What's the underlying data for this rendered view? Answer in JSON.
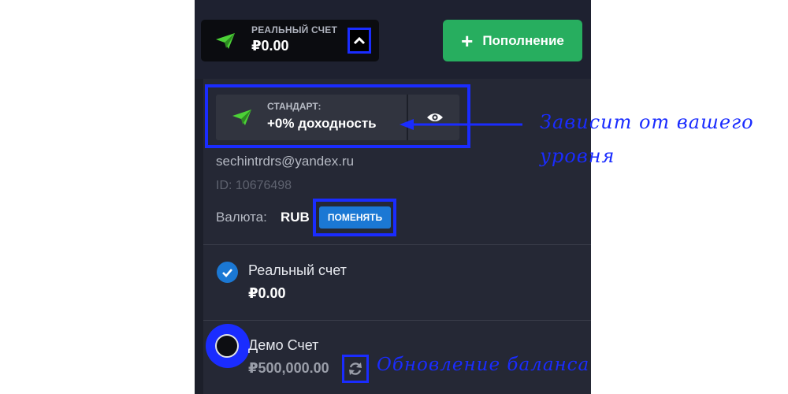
{
  "header": {
    "account_type": "РЕАЛЬНЫЙ СЧЕТ",
    "balance": "₽0.00",
    "deposit_label": "Пополнение"
  },
  "profile": {
    "tier_label": "СТАНДАРТ:",
    "tier_yield": "+0% доходность",
    "email": "sechintrdrs@yandex.ru",
    "id": "ID: 10676498",
    "currency_label": "Валюта:",
    "currency_value": "RUB",
    "change_button": "ПОМЕНЯТЬ"
  },
  "accounts": [
    {
      "label": "Реальный счет",
      "balance": "₽0.00",
      "selected": true
    },
    {
      "label": "Демо Счет",
      "balance": "₽500,000.00",
      "selected": false
    }
  ],
  "annotations": {
    "tier_note_line1": "Зависит от вашего",
    "tier_note_line2": "уровня",
    "refresh_note": "Обновление баланса"
  },
  "colors": {
    "accent_green": "#27ae5f",
    "accent_blue": "#1b78d4",
    "highlight_blue": "#1a2cff",
    "panel_bg": "#1c1f2a"
  },
  "icons": [
    "paper-plane-icon",
    "chevron-up-icon",
    "plus-icon",
    "eye-icon",
    "check-icon",
    "refresh-icon"
  ]
}
